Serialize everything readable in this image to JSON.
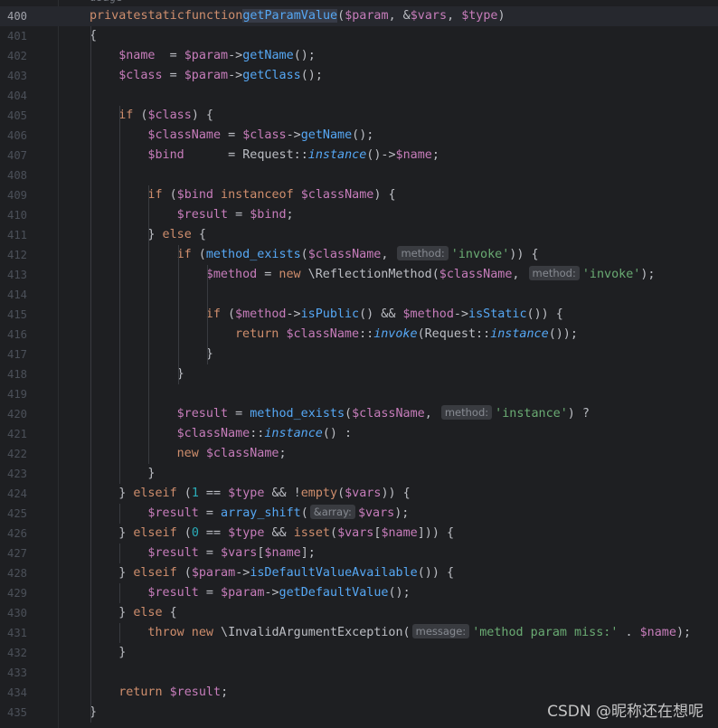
{
  "editor": {
    "current_line": 400,
    "top_fold_text": "usage",
    "lines": [
      {
        "num": "400"
      },
      {
        "num": "401"
      },
      {
        "num": "402"
      },
      {
        "num": "403"
      },
      {
        "num": "404"
      },
      {
        "num": "405"
      },
      {
        "num": "406"
      },
      {
        "num": "407"
      },
      {
        "num": "408"
      },
      {
        "num": "409"
      },
      {
        "num": "410"
      },
      {
        "num": "411"
      },
      {
        "num": "412"
      },
      {
        "num": "413"
      },
      {
        "num": "414"
      },
      {
        "num": "415"
      },
      {
        "num": "416"
      },
      {
        "num": "417"
      },
      {
        "num": "418"
      },
      {
        "num": "419"
      },
      {
        "num": "420"
      },
      {
        "num": "421"
      },
      {
        "num": "422"
      },
      {
        "num": "423"
      },
      {
        "num": "424"
      },
      {
        "num": "425"
      },
      {
        "num": "426"
      },
      {
        "num": "427"
      },
      {
        "num": "428"
      },
      {
        "num": "429"
      },
      {
        "num": "430"
      },
      {
        "num": "431"
      },
      {
        "num": "432"
      },
      {
        "num": "433"
      },
      {
        "num": "434"
      },
      {
        "num": "435"
      }
    ]
  },
  "code": {
    "l400": [
      "private",
      "static",
      "function",
      "getParamValue",
      "(",
      "$param",
      ", &",
      "$vars",
      ", ",
      "$type",
      ")"
    ],
    "l401": "{",
    "l402": [
      "$name",
      "  = ",
      "$param",
      "->",
      "getName",
      "();"
    ],
    "l403": [
      "$class",
      " = ",
      "$param",
      "->",
      "getClass",
      "();"
    ],
    "l405": [
      "if",
      " (",
      "$class",
      ") {"
    ],
    "l406": [
      "$className",
      " = ",
      "$class",
      "->",
      "getName",
      "();"
    ],
    "l407": [
      "$bind",
      "      = Request::",
      "instance",
      "()->",
      "$name",
      ";"
    ],
    "l409": [
      "if",
      " (",
      "$bind",
      " ",
      "instanceof",
      " ",
      "$className",
      ") {"
    ],
    "l410": [
      "$result",
      " = ",
      "$bind",
      ";"
    ],
    "l411": [
      "} ",
      "else",
      " {"
    ],
    "l412": [
      "if",
      " (",
      "method_exists",
      "(",
      "$className",
      ", ",
      "method:",
      "'invoke'",
      ")) {"
    ],
    "l413": [
      "$method",
      " = ",
      "new",
      " \\ReflectionMethod(",
      "$className",
      ", ",
      "method:",
      "'invoke'",
      ");"
    ],
    "l415": [
      "if",
      " (",
      "$method",
      "->",
      "isPublic",
      "() && ",
      "$method",
      "->",
      "isStatic",
      "()) {"
    ],
    "l416": [
      "return",
      " ",
      "$className",
      "::",
      "invoke",
      "(Request::",
      "instance",
      "());"
    ],
    "l417": "}",
    "l418": "}",
    "l420": [
      "$result",
      " = ",
      "method_exists",
      "(",
      "$className",
      ", ",
      "method:",
      "'instance'",
      ") ?"
    ],
    "l421": [
      "$className",
      "::",
      "instance",
      "() :"
    ],
    "l422": [
      "new",
      " ",
      "$className",
      ";"
    ],
    "l423": "}",
    "l424": [
      "} ",
      "elseif",
      " (",
      "1",
      " == ",
      "$type",
      " && !",
      "empty",
      "(",
      "$vars",
      ")) {"
    ],
    "l425": [
      "$result",
      " = ",
      "array_shift",
      "(",
      "&array:",
      "$vars",
      ");"
    ],
    "l426": [
      "} ",
      "elseif",
      " (",
      "0",
      " == ",
      "$type",
      " && ",
      "isset",
      "(",
      "$vars",
      "[",
      "$name",
      "])) {"
    ],
    "l427": [
      "$result",
      " = ",
      "$vars",
      "[",
      "$name",
      "];"
    ],
    "l428": [
      "} ",
      "elseif",
      " (",
      "$param",
      "->",
      "isDefaultValueAvailable",
      "()) {"
    ],
    "l429": [
      "$result",
      " = ",
      "$param",
      "->",
      "getDefaultValue",
      "();"
    ],
    "l430": [
      "} ",
      "else",
      " {"
    ],
    "l431": [
      "throw",
      " ",
      "new",
      " \\InvalidArgumentException(",
      "message:",
      "'method param miss:'",
      " . ",
      "$name",
      ");"
    ],
    "l432": "}",
    "l434": [
      "return",
      " ",
      "$result",
      ";"
    ],
    "l435": "}"
  },
  "watermark": "CSDN @昵称还在想呢",
  "colors": {
    "background": "#1e1f22",
    "keyword": "#cf8e6d",
    "variable": "#c77dbb",
    "function": "#56a8f5",
    "string": "#6aab73",
    "number": "#2aacb8",
    "text": "#bcbec4",
    "line_number": "#4b5059"
  }
}
